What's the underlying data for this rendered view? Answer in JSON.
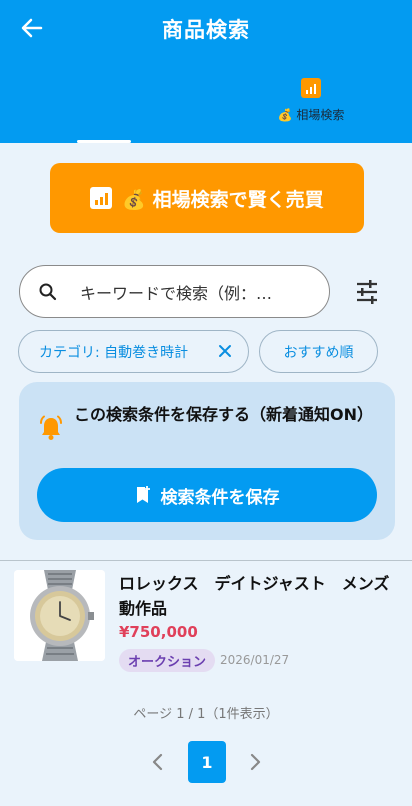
{
  "header": {
    "title": "商品検索",
    "tabs": [
      {
        "label": "💰 相場検索"
      }
    ]
  },
  "cta": {
    "label": "💰 相場検索で賢く売買"
  },
  "search": {
    "placeholder": "キーワードで検索（例：…"
  },
  "chips": {
    "category": "カテゴリ: 自動巻き時計",
    "sort": "おすすめ順"
  },
  "save_card": {
    "message": "この検索条件を保存する（新着通知ON）",
    "button_label": "検索条件を保存"
  },
  "results": [
    {
      "title": "ロレックス　デイトジャスト　メンズ動作品",
      "price": "¥750,000",
      "badge": "オークション",
      "date": "2026/01/27"
    }
  ],
  "pagination": {
    "info": "ページ 1 / 1（1件表示）",
    "current": "1"
  },
  "colors": {
    "primary": "#039bf1",
    "accent": "#ff9800",
    "price": "#e0405a"
  }
}
